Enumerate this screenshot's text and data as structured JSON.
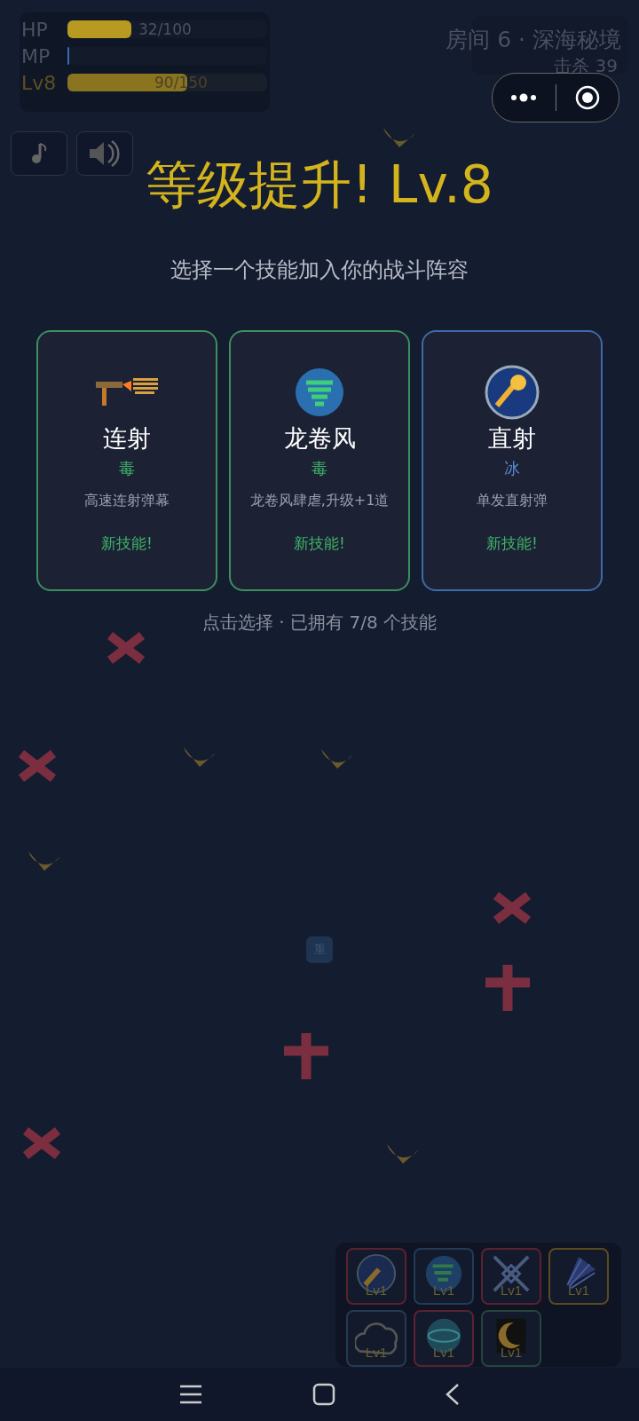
{
  "hud": {
    "bars": [
      {
        "label": "HP",
        "level": 0.32,
        "reading": "32/100",
        "kind": "hp"
      },
      {
        "label": "MP",
        "level": 0,
        "kind": "mp"
      },
      {
        "label": "Lv8",
        "level": 0.6,
        "reading": "90/150",
        "kind": "xp"
      }
    ],
    "room": "房间 6 · 深海秘境",
    "kills": "击杀 39"
  },
  "title": "等级提升! Lv.8",
  "subtitle": "选择一个技能加入你的战斗阵容",
  "cards": [
    {
      "name": "连射",
      "element": "毒",
      "color": "#3d8f5e",
      "description": "高速连射弹幕",
      "badge": "新技能!",
      "kind": "gun"
    },
    {
      "name": "龙卷风",
      "element": "毒",
      "color": "#3d8f5e",
      "description": "龙卷风肆虐,升级+1道",
      "badge": "新技能!",
      "kind": "tornado"
    },
    {
      "name": "直射",
      "element": "冰",
      "color": "#3f6aa8",
      "description": "单发直射弹",
      "badge": "新技能!",
      "kind": "fireball"
    }
  ],
  "hint": "点击选择 · 已拥有 7/8 个技能",
  "center_button": "重",
  "skills": [
    {
      "level": "Lv1",
      "color": "#5a2230",
      "kind": "fireball"
    },
    {
      "level": "Lv1",
      "color": "#243a55",
      "kind": "tornado"
    },
    {
      "level": "Lv1",
      "color": "#5a2230",
      "kind": "cross"
    },
    {
      "level": "Lv1",
      "color": "#5a4a20",
      "kind": "fan"
    },
    {
      "level": "Lv1",
      "color": "#243a55",
      "kind": "cloud"
    },
    {
      "level": "Lv1",
      "color": "#5a2230",
      "kind": "orb"
    },
    {
      "level": "Lv1",
      "color": "#24453a",
      "kind": "moon"
    }
  ]
}
